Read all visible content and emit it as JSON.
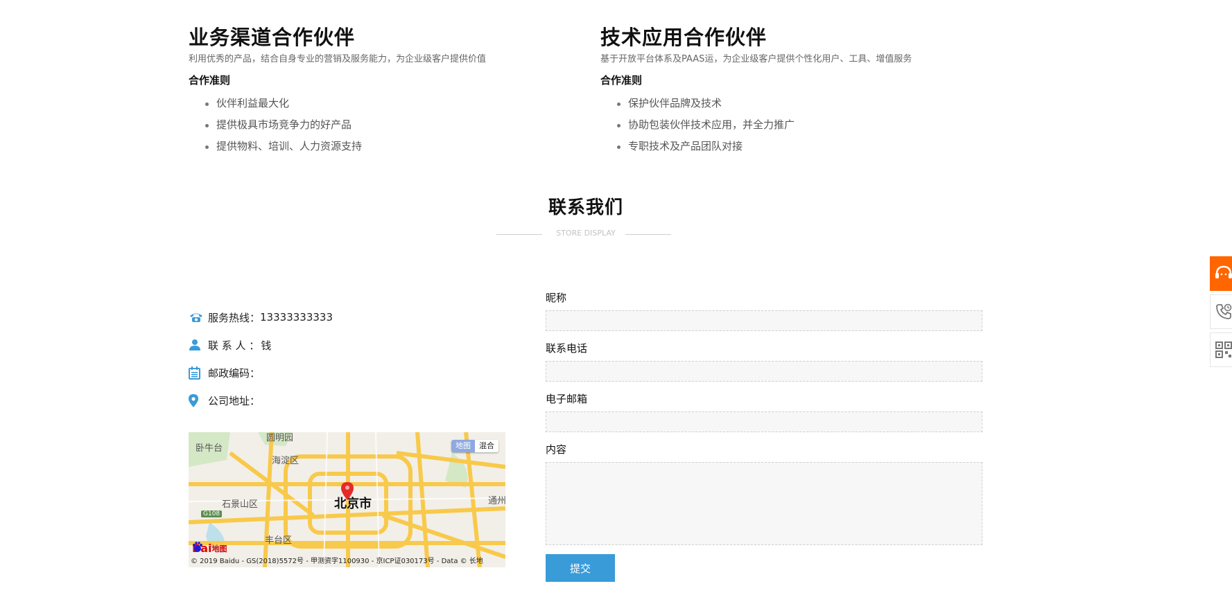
{
  "business_partner": {
    "title": "业务渠道合作伙伴",
    "subtitle": "利用优秀的产品，结合自身专业的营销及服务能力，为企业级客户提供价值",
    "principles_heading": "合作准则",
    "items": [
      "伙伴利益最大化",
      "提供极具市场竞争力的好产品",
      "提供物料、培训、人力资源支持"
    ]
  },
  "tech_partner": {
    "title": "技术应用合作伙伴",
    "subtitle": "基于开放平台体系及PAAS运，为企业级客户提供个性化用户、工具、增值服务",
    "principles_heading": "合作准则",
    "items": [
      "保护伙伴品牌及技术",
      "协助包装伙伴技术应用，并全力推广",
      "专职技术及产品团队对接"
    ]
  },
  "contact": {
    "title": "联系我们",
    "subtitle": "STORE DISPLAY",
    "hotline_label": "服务热线：",
    "hotline_value": "13333333333",
    "person_label": "联 系 人 ：",
    "person_value": "钱",
    "postcode_label": "邮政编码：",
    "address_label": "公司地址："
  },
  "map": {
    "toggle_map": "地图",
    "toggle_hybrid": "混合",
    "city": "北京市",
    "labels": [
      "海淀区",
      "石景山区",
      "丰台区",
      "卧牛台",
      "圆明园",
      "通州",
      "G108"
    ],
    "logo_text": "Bai",
    "logo_suffix": "地图",
    "copyright": "© 2019 Baidu - GS(2018)5572号 - 甲测资字1100930 - 京ICP证030173号 - Data © 长地"
  },
  "form": {
    "nickname_label": "昵称",
    "phone_label": "联系电话",
    "email_label": "电子邮箱",
    "content_label": "内容",
    "submit_label": "提交"
  },
  "colors": {
    "accent_blue": "#3a9bd9",
    "float_orange": "#ff6600",
    "map_road": "#f8c94a"
  },
  "icons": [
    "phone-icon",
    "user-icon",
    "calendar-icon",
    "location-pin-icon",
    "customer-service-icon",
    "phone-call-icon",
    "qrcode-icon",
    "map-marker-icon"
  ]
}
